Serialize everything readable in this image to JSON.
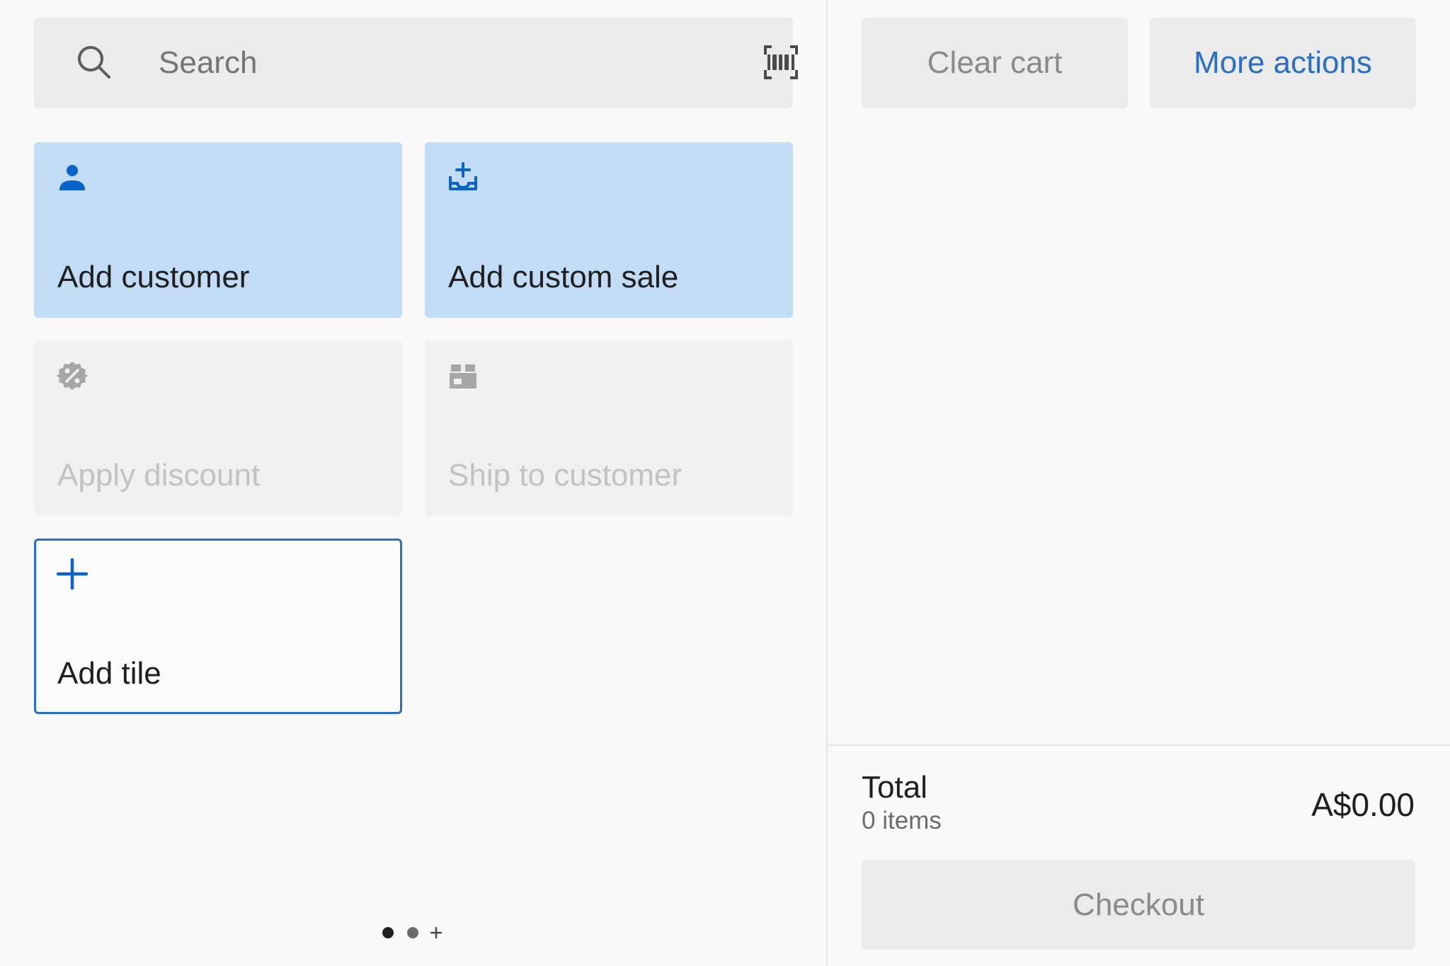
{
  "search": {
    "placeholder": "Search",
    "icon": "search-icon",
    "scan_icon": "barcode-scan-icon"
  },
  "tiles": [
    {
      "label": "Add customer",
      "icon": "person-icon",
      "state": "primary"
    },
    {
      "label": "Add custom sale",
      "icon": "add-custom-sale-icon",
      "state": "primary"
    },
    {
      "label": "Apply discount",
      "icon": "discount-badge-icon",
      "state": "disabled"
    },
    {
      "label": "Ship to customer",
      "icon": "shipping-box-icon",
      "state": "disabled"
    },
    {
      "label": "Add tile",
      "icon": "plus-icon",
      "state": "outline"
    }
  ],
  "pager": {
    "pages": 2,
    "current": 1,
    "add_icon": "plus-icon"
  },
  "cart": {
    "clear_label": "Clear cart",
    "more_label": "More actions",
    "total_label": "Total",
    "items_label": "0 items",
    "total_amount": "A$0.00",
    "checkout_label": "Checkout"
  },
  "colors": {
    "accent": "#2a6fc4",
    "tile_primary_bg": "#c1dcf4",
    "tile_disabled_bg": "#f0f0f0",
    "button_bg": "#ebebeb",
    "background": "#f9f9f9"
  }
}
